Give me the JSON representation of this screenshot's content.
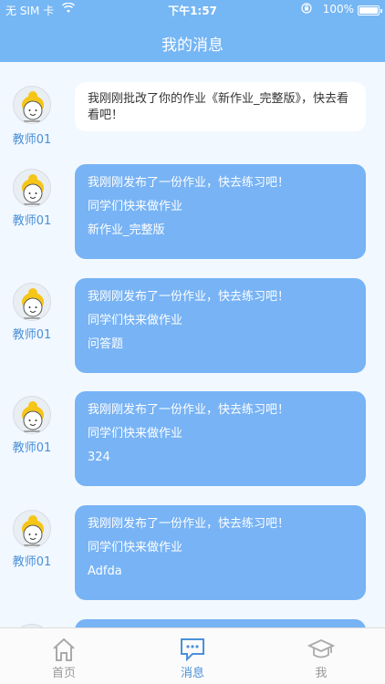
{
  "status_bar": {
    "carrier": "无 SIM 卡",
    "time": "下午1:57",
    "battery": "100%",
    "battery_level": 1.0
  },
  "nav": {
    "title": "我的消息"
  },
  "messages": [
    {
      "sender": "教师01",
      "style": "white",
      "lines": [
        "我刚刚批改了你的作业《新作业_完整版》，快去看看吧！"
      ]
    },
    {
      "sender": "教师01",
      "style": "blue",
      "lines": [
        "我刚刚发布了一份作业，快去练习吧！",
        "同学们快来做作业",
        "新作业_完整版"
      ]
    },
    {
      "sender": "教师01",
      "style": "blue",
      "lines": [
        "我刚刚发布了一份作业，快去练习吧！",
        "同学们快来做作业",
        "问答题"
      ]
    },
    {
      "sender": "教师01",
      "style": "blue",
      "lines": [
        "我刚刚发布了一份作业，快去练习吧！",
        "同学们快来做作业",
        "324"
      ]
    },
    {
      "sender": "教师01",
      "style": "blue",
      "lines": [
        "我刚刚发布了一份作业，快去练习吧！",
        "同学们快来做作业",
        "Adfda"
      ]
    }
  ],
  "tabs": [
    {
      "label": "首页",
      "icon": "home-icon",
      "active": false
    },
    {
      "label": "消息",
      "icon": "message-icon",
      "active": true
    },
    {
      "label": "我",
      "icon": "graduation-cap-icon",
      "active": false
    }
  ],
  "colors": {
    "accent": "#75b6f4",
    "bubble_blue": "#77b3f5",
    "sender": "#4a90d9"
  }
}
